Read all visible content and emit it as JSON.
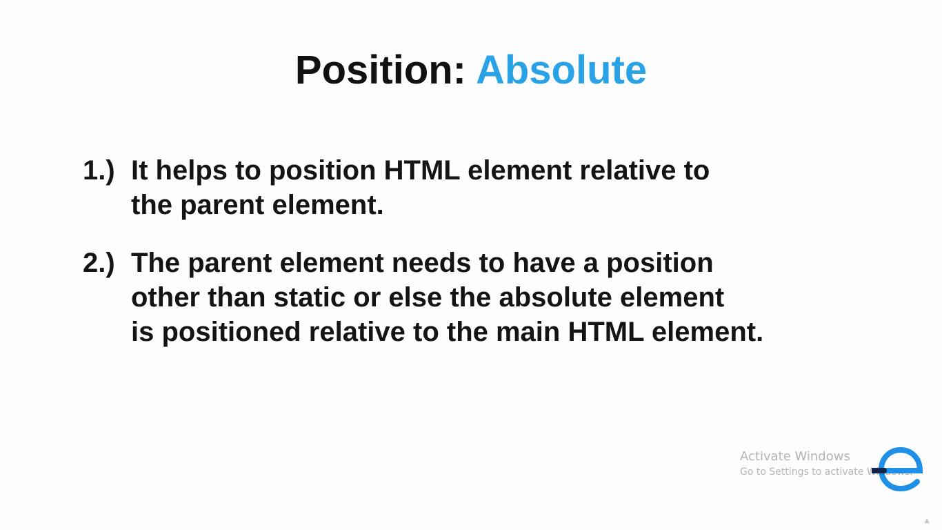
{
  "slide": {
    "title_prefix": "Position: ",
    "title_accent": "Absolute",
    "accent_color": "#2aa3e6",
    "points": [
      {
        "number": "1.)",
        "lines": [
          "It helps to position HTML element relative to",
          "the parent element."
        ]
      },
      {
        "number": "2.)",
        "lines": [
          "The parent element needs to have a position",
          "other than static or else the absolute element",
          "is positioned relative to the main HTML element."
        ]
      }
    ]
  },
  "watermark": {
    "title": "Activate Windows",
    "subtitle": "Go to Settings to activate Windows."
  },
  "logo": {
    "icon": "e-logo-icon",
    "color": "#1e90e8"
  }
}
